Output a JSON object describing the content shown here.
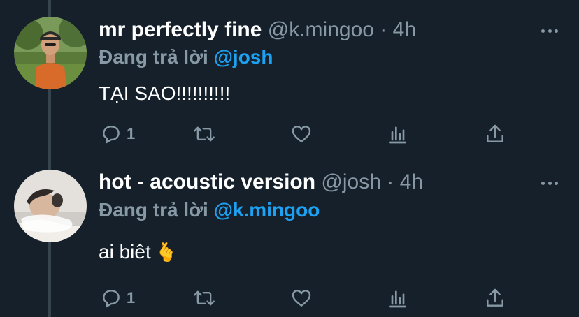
{
  "tweets": [
    {
      "display_name": "mr perfectly fine",
      "handle": "@k.mingoo",
      "separator": "·",
      "time": "4h",
      "replying_label": "Đang trả lời",
      "replying_to": "@josh",
      "text": "TẠI SAO!!!!!!!!!!",
      "emoji": "",
      "reply_count": "1",
      "avatar_icon": "person-outdoor-photo",
      "accent_color": "#1da1f2"
    },
    {
      "display_name": "hot - acoustic version",
      "handle": "@josh",
      "separator": "·",
      "time": "4h",
      "replying_label": "Đang trả lời",
      "replying_to": "@k.mingoo",
      "text": "ai biêt",
      "emoji": "🫰",
      "reply_count": "1",
      "avatar_icon": "person-lying-photo",
      "accent_color": "#1da1f2"
    }
  ],
  "icons": {
    "reply": "speech-bubble-icon",
    "retweet": "retweet-icon",
    "like": "heart-icon",
    "stats": "bar-chart-icon",
    "share": "share-icon",
    "more": "more-dots-icon"
  },
  "colors": {
    "background": "#15202b",
    "text_primary": "#ffffff",
    "text_secondary": "#8899a6",
    "link": "#1da1f2",
    "thread_line": "#38444d"
  }
}
